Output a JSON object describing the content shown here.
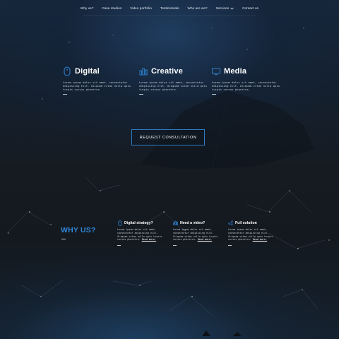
{
  "nav": {
    "items": [
      {
        "label": "Why us?"
      },
      {
        "label": "Case studies"
      },
      {
        "label": "Video portfolio"
      },
      {
        "label": "Testimonials"
      },
      {
        "label": "Who are we?"
      },
      {
        "label": "Services",
        "icon": "chevron-down-icon"
      },
      {
        "label": "Contact us"
      }
    ]
  },
  "features": [
    {
      "icon": "mouse-icon",
      "title": "Digital",
      "text": "Lorem ipsum dolor sit amet, consectetur adipiscing elit. Aliquam vitae nulla quis turpis cursus pharetra."
    },
    {
      "icon": "bar-chart-icon",
      "title": "Creative",
      "text": "Lorem ipsum dolor sit amet, consectetur adipiscing elit. Aliquam vitae nulla quis turpis cursus pharetra."
    },
    {
      "icon": "monitor-icon",
      "title": "Media",
      "text": "Lorem ipsum dolor sit amet, consectetur adipiscing elit. Aliquam vitae nulla quis turpis cursus pharetra."
    }
  ],
  "cta": {
    "label": "REQUEST CONSULTATION"
  },
  "why": {
    "title": "WHY US?",
    "items": [
      {
        "icon": "mouse-icon",
        "title": "Digital strategy?",
        "text": "Lorem ipsum dolor sit amet, consectetur adipiscing elit. Aliquam vitae nulla quis turpis cursus pharetra.",
        "more": "Read more."
      },
      {
        "icon": "bar-chart-icon",
        "title": "Need a video?",
        "text": "Lorem ipsum dolor sit amet, consectetur adipiscing elit. Aliquam vitae nulla quis turpis cursus pharetra.",
        "more": "Read more."
      },
      {
        "icon": "share-icon",
        "title": "Full solution",
        "text": "Lorem ipsum dolor sit amet, consectetur adipiscing elit. Aliquam vitae nulla quis turpis cursus pharetra.",
        "more": "Read more."
      }
    ]
  },
  "colors": {
    "accent": "#2f86d6",
    "cta_border": "#2d7bc4",
    "text": "#e8eef4"
  }
}
